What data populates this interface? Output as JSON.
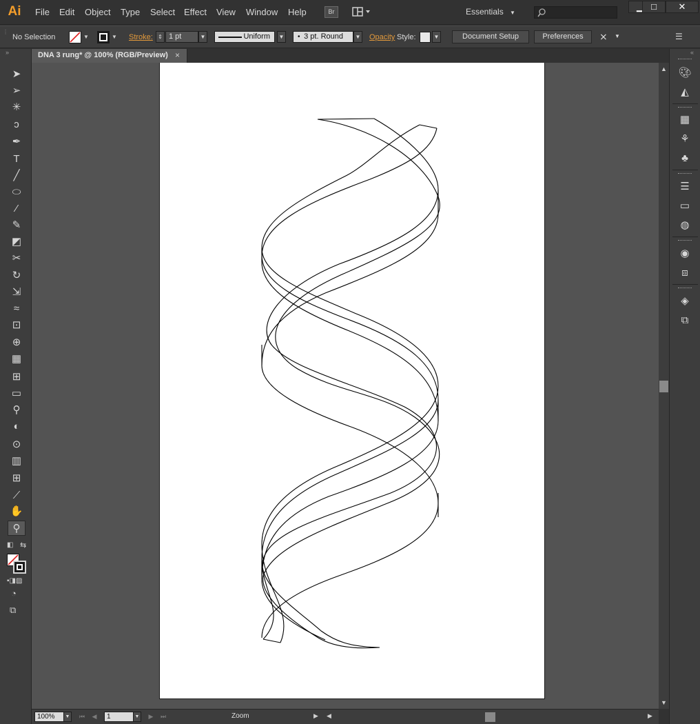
{
  "app": {
    "logo": "Ai"
  },
  "menu": [
    "File",
    "Edit",
    "Object",
    "Type",
    "Select",
    "Effect",
    "View",
    "Window",
    "Help"
  ],
  "bridge_label": "Br",
  "workspace": {
    "label": "Essentials"
  },
  "window_controls": {
    "minimize": "▁",
    "maximize": "□",
    "close": "✕"
  },
  "control_bar": {
    "selection": "No Selection",
    "stroke_label": "Stroke:",
    "stroke_weight": "1 pt",
    "stroke_profile": "Uniform",
    "brush": "3 pt. Round",
    "opacity_label": "Opacity",
    "style_label": "Style:",
    "document_setup": "Document Setup",
    "preferences": "Preferences"
  },
  "document": {
    "tab_title": "DNA 3 rung* @ 100% (RGB/Preview)",
    "close": "×"
  },
  "status_bar": {
    "zoom": "100%",
    "page": "1",
    "status": "Zoom"
  },
  "tools": [
    {
      "name": "selection-tool",
      "glyph": "➤"
    },
    {
      "name": "direct-selection-tool",
      "glyph": "➢"
    },
    {
      "name": "magic-wand-tool",
      "glyph": "✳"
    },
    {
      "name": "lasso-tool",
      "glyph": "ↄ"
    },
    {
      "name": "pen-tool",
      "glyph": "✒"
    },
    {
      "name": "type-tool",
      "glyph": "T"
    },
    {
      "name": "line-segment-tool",
      "glyph": "╱"
    },
    {
      "name": "ellipse-tool",
      "glyph": "⬭"
    },
    {
      "name": "paintbrush-tool",
      "glyph": "⁄"
    },
    {
      "name": "pencil-tool",
      "glyph": "✎"
    },
    {
      "name": "blob-brush-tool",
      "glyph": "◩"
    },
    {
      "name": "scissors-tool",
      "glyph": "✂"
    },
    {
      "name": "rotate-tool",
      "glyph": "↻"
    },
    {
      "name": "scale-tool",
      "glyph": "⇲"
    },
    {
      "name": "warp-tool",
      "glyph": "≈"
    },
    {
      "name": "free-transform-tool",
      "glyph": "⊡"
    },
    {
      "name": "shape-builder-tool",
      "glyph": "⊕"
    },
    {
      "name": "perspective-grid-tool",
      "glyph": "▦"
    },
    {
      "name": "mesh-tool",
      "glyph": "⊞"
    },
    {
      "name": "gradient-tool",
      "glyph": "▭"
    },
    {
      "name": "eyedropper-tool",
      "glyph": "⚲"
    },
    {
      "name": "blend-tool",
      "glyph": "◐"
    },
    {
      "name": "symbol-sprayer-tool",
      "glyph": "⊙"
    },
    {
      "name": "column-graph-tool",
      "glyph": "▥"
    },
    {
      "name": "artboard-tool",
      "glyph": "⊞"
    },
    {
      "name": "slice-tool",
      "glyph": "⟋"
    },
    {
      "name": "hand-tool",
      "glyph": "✋"
    },
    {
      "name": "zoom-tool",
      "glyph": "⚲"
    }
  ],
  "colors": {
    "accent": "#f39d2a",
    "stroke_label": "#e39a3c",
    "artboard": "#ffffff",
    "canvas": "#535353"
  }
}
